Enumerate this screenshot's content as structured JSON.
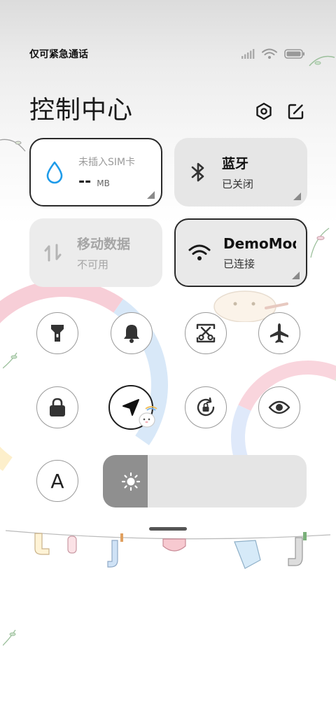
{
  "status_bar": {
    "carrier": "仅可紧急通话",
    "icons": [
      "signal-icon",
      "wifi-icon",
      "battery-icon"
    ]
  },
  "header": {
    "title": "控制中心",
    "settings_icon": "hexagon-settings-icon",
    "edit_icon": "edit-icon"
  },
  "tiles": {
    "data_usage": {
      "title": "未插入SIM卡",
      "value": "--",
      "unit": "MB",
      "icon": "water-drop-icon",
      "color": "#1e9be9"
    },
    "bluetooth": {
      "title": "蓝牙",
      "status": "已关闭",
      "icon": "bluetooth-icon"
    },
    "mobile_data": {
      "title": "移动数据",
      "status": "不可用",
      "icon": "arrows-up-down-icon"
    },
    "wifi": {
      "title": "DemoMode",
      "status": "已连接",
      "icon": "wifi-icon"
    }
  },
  "toggles": [
    {
      "name": "flashlight",
      "icon": "flashlight-icon",
      "on": false
    },
    {
      "name": "silent",
      "icon": "bell-icon",
      "on": false
    },
    {
      "name": "screenshot",
      "icon": "scissors-icon",
      "on": false
    },
    {
      "name": "airplane",
      "icon": "airplane-icon",
      "on": false
    },
    {
      "name": "lock-screen",
      "icon": "lock-icon",
      "on": false
    },
    {
      "name": "location",
      "icon": "location-arrow-icon",
      "on": true
    },
    {
      "name": "rotation-lock",
      "icon": "rotation-lock-icon",
      "on": false
    },
    {
      "name": "reading-mode",
      "icon": "eye-icon",
      "on": false
    },
    {
      "name": "auto-brightness",
      "icon": "letter-a-icon",
      "label": "A",
      "on": false
    }
  ],
  "brightness": {
    "level": 0.22,
    "icon": "sun-icon"
  },
  "colors": {
    "tile_bg": "#e6e6e6",
    "accent_dark": "#1e1e1e",
    "page_bg": "#ffffff"
  }
}
